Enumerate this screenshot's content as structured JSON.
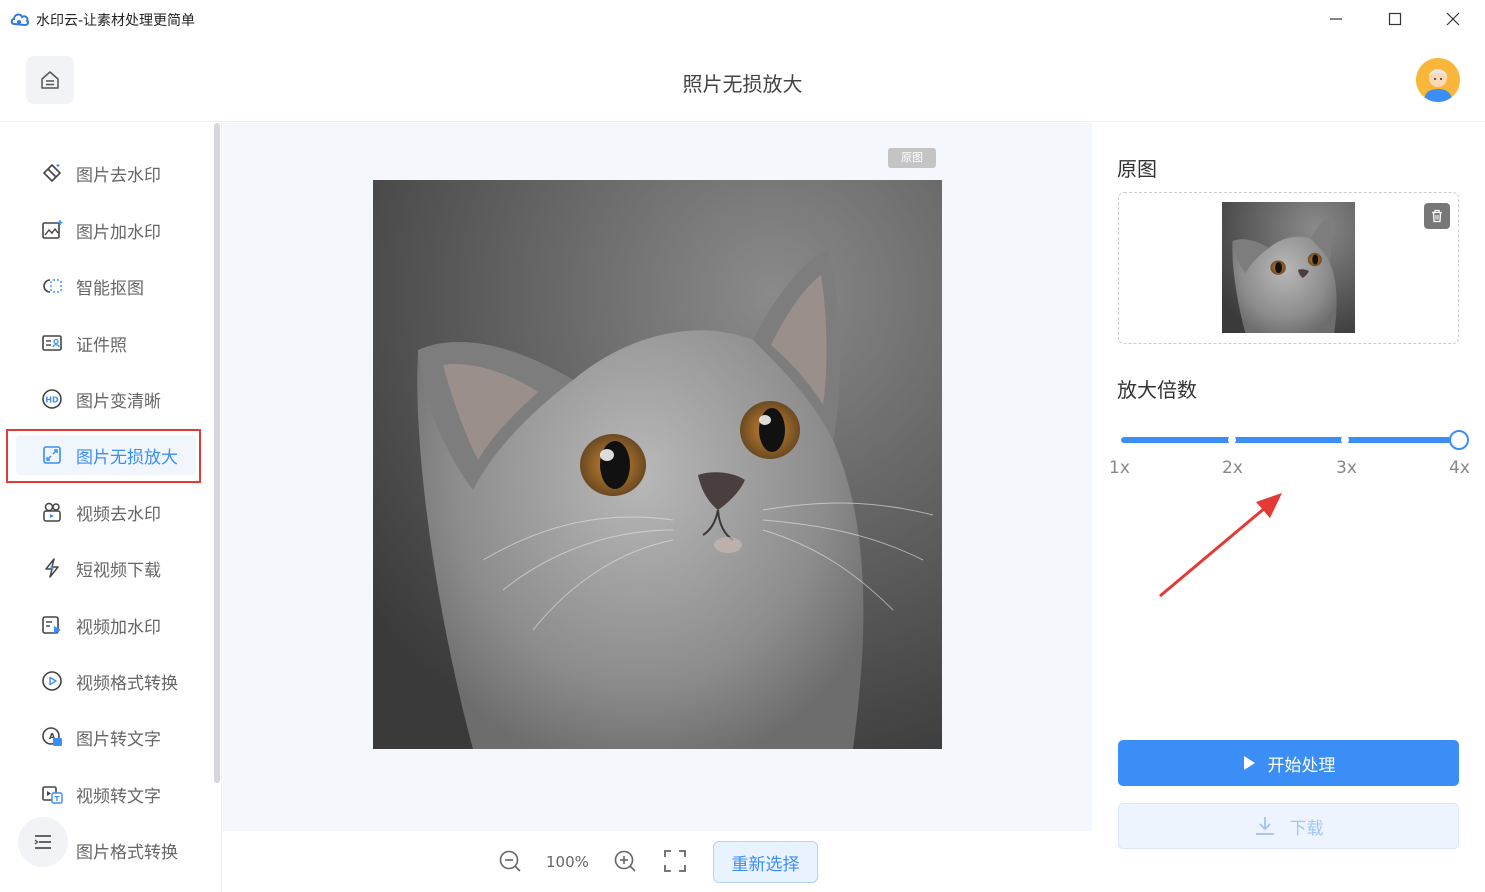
{
  "window": {
    "title": "水印云-让素材处理更简单"
  },
  "header": {
    "page_title": "照片无损放大"
  },
  "sidebar": {
    "items": [
      {
        "label": "图片去水印",
        "icon": "eraser-diamond-icon"
      },
      {
        "label": "图片加水印",
        "icon": "image-sparkle-icon"
      },
      {
        "label": "智能抠图",
        "icon": "cutout-icon"
      },
      {
        "label": "证件照",
        "icon": "id-card-icon"
      },
      {
        "label": "图片变清晰",
        "icon": "hd-icon"
      },
      {
        "label": "图片无损放大",
        "icon": "expand-arrows-icon",
        "active": true
      },
      {
        "label": "视频去水印",
        "icon": "video-eraser-icon"
      },
      {
        "label": "短视频下载",
        "icon": "short-video-icon"
      },
      {
        "label": "视频加水印",
        "icon": "video-add-icon"
      },
      {
        "label": "视频格式转换",
        "icon": "play-circle-icon"
      },
      {
        "label": "图片转文字",
        "icon": "image-text-icon"
      },
      {
        "label": "视频转文字",
        "icon": "video-text-icon"
      },
      {
        "label": "图片格式转换",
        "icon": "image-convert-icon"
      }
    ]
  },
  "canvas": {
    "tag": "原图"
  },
  "toolbar": {
    "zoom": "100%",
    "reselect_label": "重新选择"
  },
  "panel": {
    "original_heading": "原图",
    "scale_heading": "放大倍数",
    "scale_options": [
      "1x",
      "2x",
      "3x",
      "4x"
    ],
    "selected_scale": "4x",
    "start_label": "开始处理",
    "download_label": "下载"
  },
  "colors": {
    "accent": "#3a8ef6",
    "highlight_outline": "#e53935"
  }
}
